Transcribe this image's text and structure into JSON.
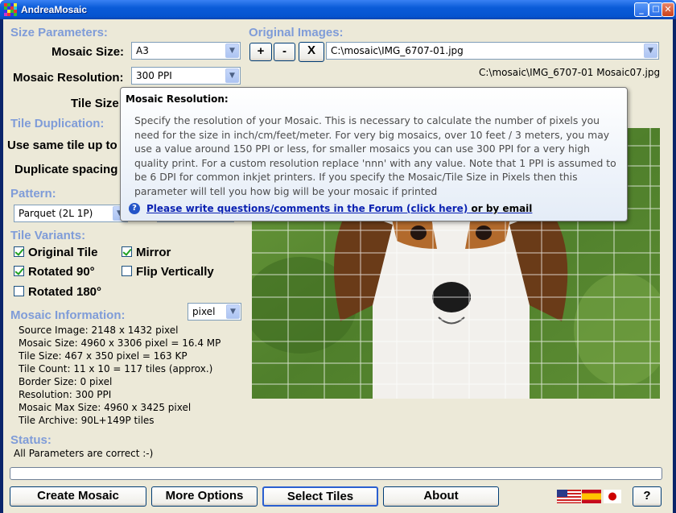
{
  "window": {
    "title": "AndreaMosaic",
    "minimize": "_",
    "maximize": "□",
    "close": "✕"
  },
  "size_params": {
    "heading": "Size Parameters:",
    "mosaic_size_label": "Mosaic Size:",
    "mosaic_size_value": "A3",
    "resolution_label": "Mosaic Resolution:",
    "resolution_value": "300 PPI",
    "tile_size_label": "Tile Size"
  },
  "original_images": {
    "heading": "Original Images:",
    "add_label": "+",
    "remove_label": "-",
    "clear_label": "X",
    "path_value": "C:\\mosaic\\IMG_6707-01.jpg",
    "output_name": "C:\\mosaic\\IMG_6707-01 Mosaic07.jpg"
  },
  "tile_duplication": {
    "heading": "Tile Duplication:",
    "use_same_label": "Use same tile up to",
    "duplicate_spacing_label": "Duplicate spacing"
  },
  "pattern": {
    "heading": "Pattern:",
    "value": "Parquet (2L 1P)"
  },
  "tile_variants": {
    "heading": "Tile Variants:",
    "items": [
      {
        "label": "Original Tile",
        "checked": true
      },
      {
        "label": "Mirror",
        "checked": true
      },
      {
        "label": "Rotated 90°",
        "checked": true
      },
      {
        "label": "Flip Vertically",
        "checked": false
      },
      {
        "label": "Rotated 180°",
        "checked": false
      }
    ]
  },
  "mosaic_info": {
    "heading": "Mosaic Information:",
    "unit_value": "pixel",
    "lines": [
      "Source Image: 2148 x 1432 pixel",
      "Mosaic Size: 4960 x 3306 pixel = 16.4 MP",
      "Tile Size: 467 x 350 pixel = 163 KP",
      "Tile Count: 11 x 10 = 117 tiles (approx.)",
      "Border Size: 0 pixel",
      "Resolution: 300 PPI",
      "Mosaic Max Size: 4960 x 3425 pixel",
      "Tile Archive: 90L+149P tiles"
    ]
  },
  "status": {
    "heading": "Status:",
    "text": "All Parameters are correct :-)"
  },
  "tooltip": {
    "title": "Mosaic Resolution:",
    "body": "Specify the resolution of your Mosaic. This is necessary to calculate the number of pixels you need for the size in inch/cm/feet/meter. For very big mosaics, over 10 feet / 3 meters, you may use a value around 150 PPI or less, for smaller mosaics you can use 300 PPI for a very high quality print. For a custom resolution replace 'nnn' with any value. Note that 1 PPI is assumed to be 6 DPI for common inkjet printers. If you specify the Mosaic/Tile Size in Pixels then this parameter will tell you how big will be your mosaic if printed",
    "forum_link": "Please write questions/comments in the Forum (click here)",
    "email_link": "or by email",
    "help_glyph": "?"
  },
  "buttons": {
    "create": "Create Mosaic",
    "more_options": "More Options",
    "select_tiles": "Select Tiles",
    "about": "About",
    "help": "?"
  },
  "colors": {
    "section_heading": "#7f9cd8",
    "link": "#0b22b2",
    "titlebar": "#0554d0"
  }
}
